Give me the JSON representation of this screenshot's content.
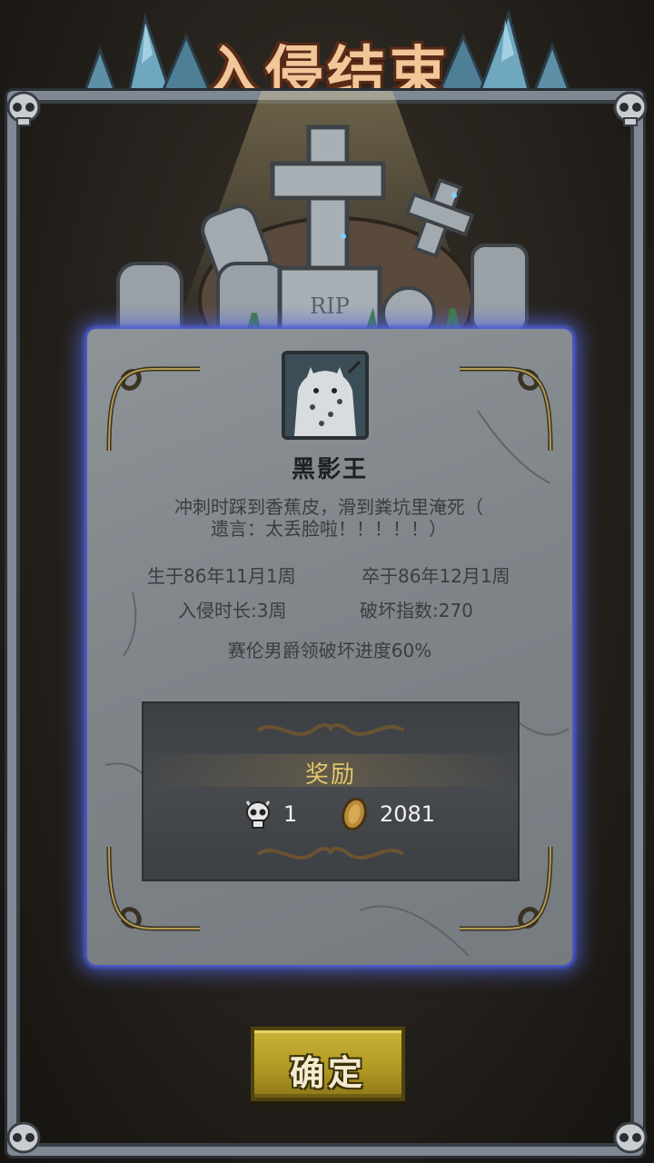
{
  "title": "入侵结束",
  "graves": {
    "cross_text": "RIP"
  },
  "character": {
    "name": "黑影王",
    "epitaph_line1": "冲刺时踩到香蕉皮，滑到粪坑里淹死（",
    "epitaph_line2": "遗言：太丢脸啦！！！！！）"
  },
  "stats": {
    "born": "生于86年11月1周",
    "died": "卒于86年12月1周",
    "duration": "入侵时长:3周",
    "destruction": "破坏指数:270",
    "progress": "赛伦男爵领破坏进度60%"
  },
  "rewards": {
    "title": "奖励",
    "items": [
      {
        "icon": "skull-icon",
        "value": "1"
      },
      {
        "icon": "gold-coin-icon",
        "value": "2081"
      }
    ]
  },
  "confirm_label": "确定",
  "colors": {
    "title": "#f1c79a",
    "panel_glow": "#4a55c8",
    "reward_title": "#e2c56a",
    "button": "#b09723"
  }
}
